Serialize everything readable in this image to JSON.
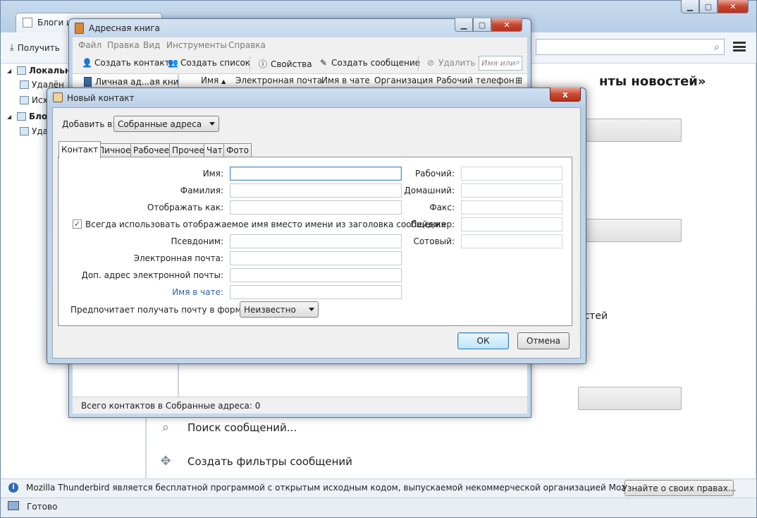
{
  "main": {
    "tab_title": "Блоги и",
    "get_label": "Получить",
    "folders": [
      {
        "label": "Локальны",
        "bold": true
      },
      {
        "label": "Удалён",
        "bold": false
      },
      {
        "label": "Исх",
        "bold": false
      },
      {
        "label": "Блог",
        "bold": true
      },
      {
        "label": "Уда",
        "bold": false
      }
    ],
    "heading_fragment": "нты новостей»",
    "news_fragment": "остей",
    "actions": [
      "Поиск сообщений...",
      "Создать фильтры сообщений"
    ],
    "notification_text": "Mozilla Thunderbird является бесплатной программой с открытым исходным кодом, выпускаемой некоммерческой организацией Mozilla Foundation.",
    "notification_button": "Узнайте о своих правах...",
    "status": "Готово"
  },
  "address_book": {
    "title": "Адресная книга",
    "menu": [
      "Файл",
      "Правка",
      "Вид",
      "Инструменты",
      "Справка"
    ],
    "toolbar": {
      "new_contact": "Создать контакт",
      "new_list": "Создать список",
      "properties": "Свойства",
      "write": "Создать сообщение",
      "delete": "Удалить"
    },
    "search_placeholder": "Имя или",
    "directory": "Личная ад...ая книга",
    "columns": [
      "Имя",
      "Электронная почта",
      "Имя в чате",
      "Организация",
      "Рабочий телефон"
    ],
    "status": "Всего контактов в Собранные адреса: 0"
  },
  "new_contact": {
    "title": "Новый контакт",
    "close_label": "x",
    "add_to_label": "Добавить в:",
    "add_to_value": "Собранные адреса",
    "tabs": [
      "Контакт",
      "Личное",
      "Рабочее",
      "Прочее",
      "Чат",
      "Фото"
    ],
    "fields": {
      "first_name": "Имя:",
      "last_name": "Фамилия:",
      "display_name": "Отображать как:",
      "nickname": "Псевдоним:",
      "email": "Электронная почта:",
      "additional_email": "Доп. адрес электронной почты:",
      "chat_name": "Имя в чате:"
    },
    "always_use_display": "Всегда использовать отображаемое имя вместо имени из заголовка сообщения",
    "always_use_display_checked": true,
    "phones": {
      "work": "Рабочий:",
      "home": "Домашний:",
      "fax": "Факс:",
      "pager": "Пейджер:",
      "mobile": "Сотовый:"
    },
    "format_label": "Предпочитает получать почту в формате:",
    "format_value": "Неизвестно",
    "ok": "ОК",
    "cancel": "Отмена"
  },
  "colors": {
    "link": "#2b62a6",
    "close": "#c6472f",
    "focus": "#5a8fc9"
  }
}
